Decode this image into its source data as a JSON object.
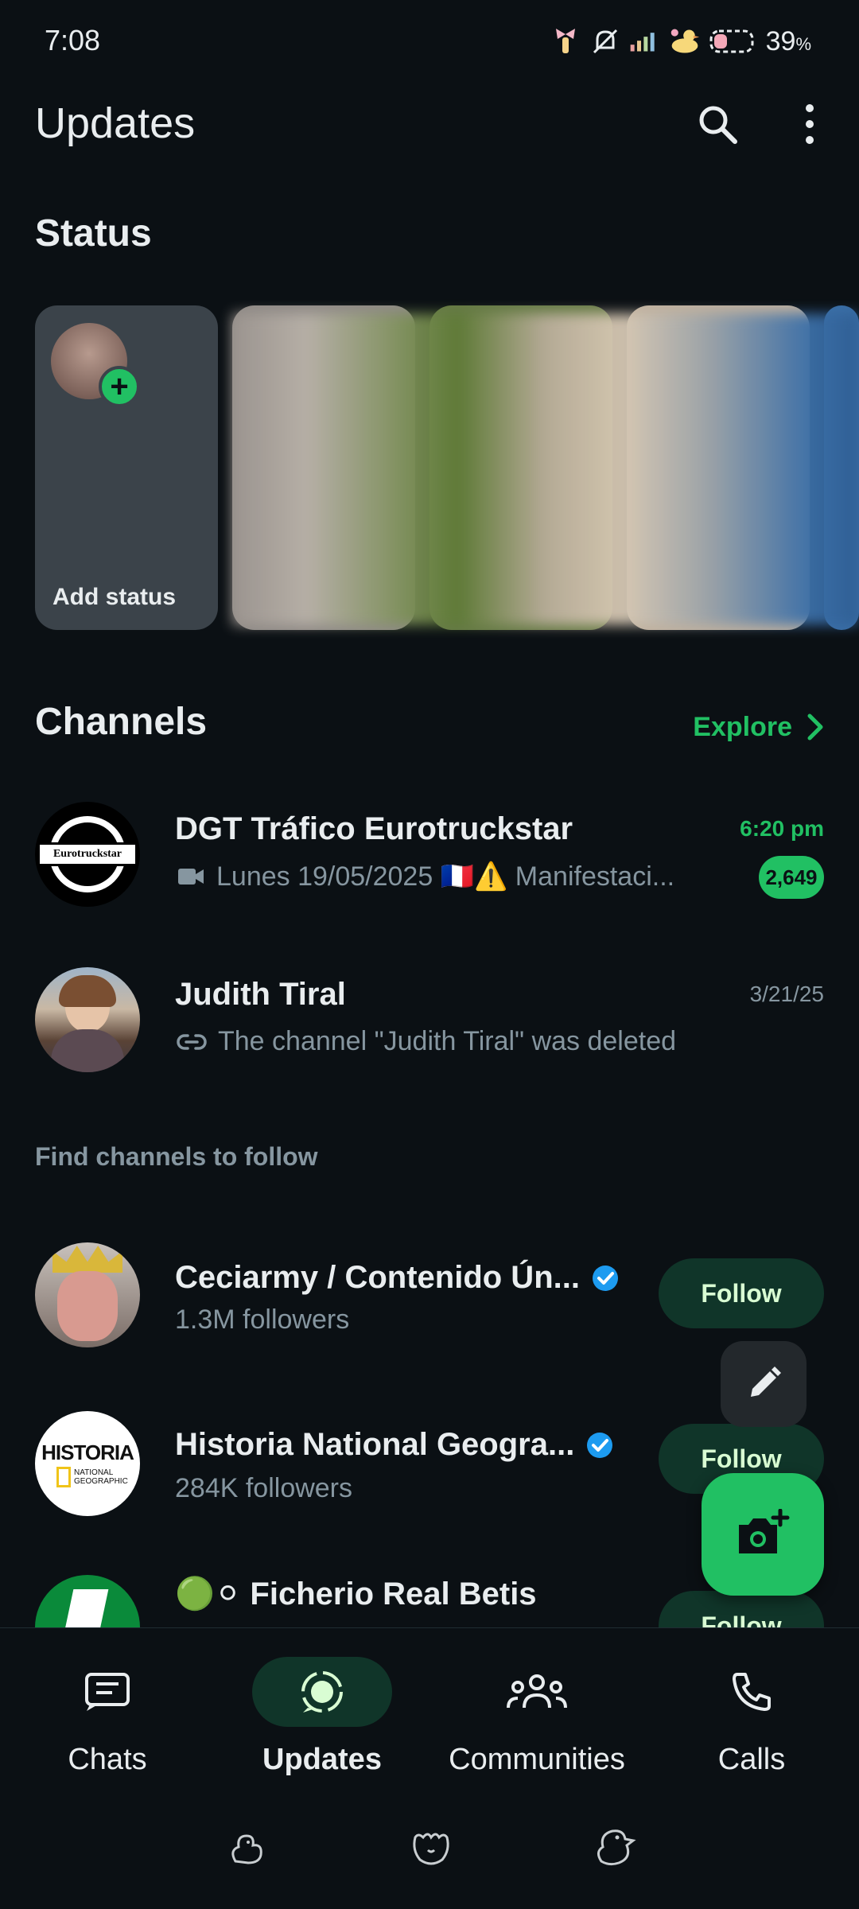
{
  "status_bar": {
    "time": "7:08",
    "battery": "39",
    "battery_unit": "%"
  },
  "header": {
    "title": "Updates"
  },
  "status_section": {
    "title": "Status",
    "add_label": "Add status"
  },
  "channels": {
    "title": "Channels",
    "explore_label": "Explore",
    "items": [
      {
        "name": "DGT Tráfico Eurotruckstar",
        "time": "6:20 pm",
        "preview": "Lunes 19/05/2025 🇫🇷⚠️ Manifestaci...",
        "unread": "2,649",
        "avatar_text": "Eurotruckstar"
      },
      {
        "name": "Judith Tiral",
        "time": "3/21/25",
        "preview": "The channel \"Judith Tiral\" was deleted"
      }
    ]
  },
  "find": {
    "label": "Find channels to follow",
    "items": [
      {
        "name": "Ceciarmy / Contenido Ún...",
        "followers": "1.3M followers",
        "button": "Follow"
      },
      {
        "name": "Historia National Geogra...",
        "followers": "284K followers",
        "button": "Follow",
        "logo_top": "HISTORIA",
        "logo_sub": "NATIONAL GEOGRAPHIC"
      },
      {
        "name": "🟢⚪ Ficherio Real Betis",
        "button": "Follow"
      }
    ]
  },
  "nav": {
    "items": [
      {
        "label": "Chats",
        "icon": "chats-icon",
        "active": false
      },
      {
        "label": "Updates",
        "icon": "updates-icon",
        "active": true
      },
      {
        "label": "Communities",
        "icon": "communities-icon",
        "active": false
      },
      {
        "label": "Calls",
        "icon": "calls-icon",
        "active": false
      }
    ]
  },
  "colors": {
    "accent": "#21c063",
    "background": "#0b1014",
    "muted": "#8696a0",
    "follow_bg": "#103529"
  }
}
